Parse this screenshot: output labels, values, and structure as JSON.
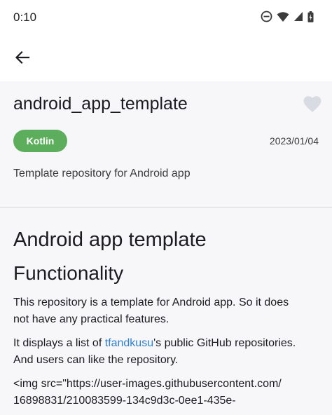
{
  "status_bar": {
    "time": "0:10",
    "icons": [
      "do-not-disturb-icon",
      "wifi-icon",
      "signal-icon",
      "battery-icon"
    ]
  },
  "app_bar": {
    "back_icon": "arrow-back-icon"
  },
  "repo": {
    "name": "android_app_template",
    "favorite_icon": "heart-icon",
    "language": "Kotlin",
    "language_color": "#5cae5c",
    "date": "2023/01/04",
    "description": "Template repository for Android app"
  },
  "readme": {
    "heading1": "Android app template",
    "heading2": "Functionality",
    "para1_line1": "This repository is a template for Android app. So it does",
    "para1_line2": "not have any practical features.",
    "para2_pre": "It displays a list of ",
    "para2_link": "tfandkusu",
    "para2_post": "'s public GitHub repositories.",
    "para2_line2": "And users can like the repository.",
    "para3_line1": "<img src=\"https://user-images.githubusercontent.com/",
    "para3_line2": "16898831/210083599-134c9d3c-0ee1-435e-",
    "link_color": "#2f80d1"
  }
}
